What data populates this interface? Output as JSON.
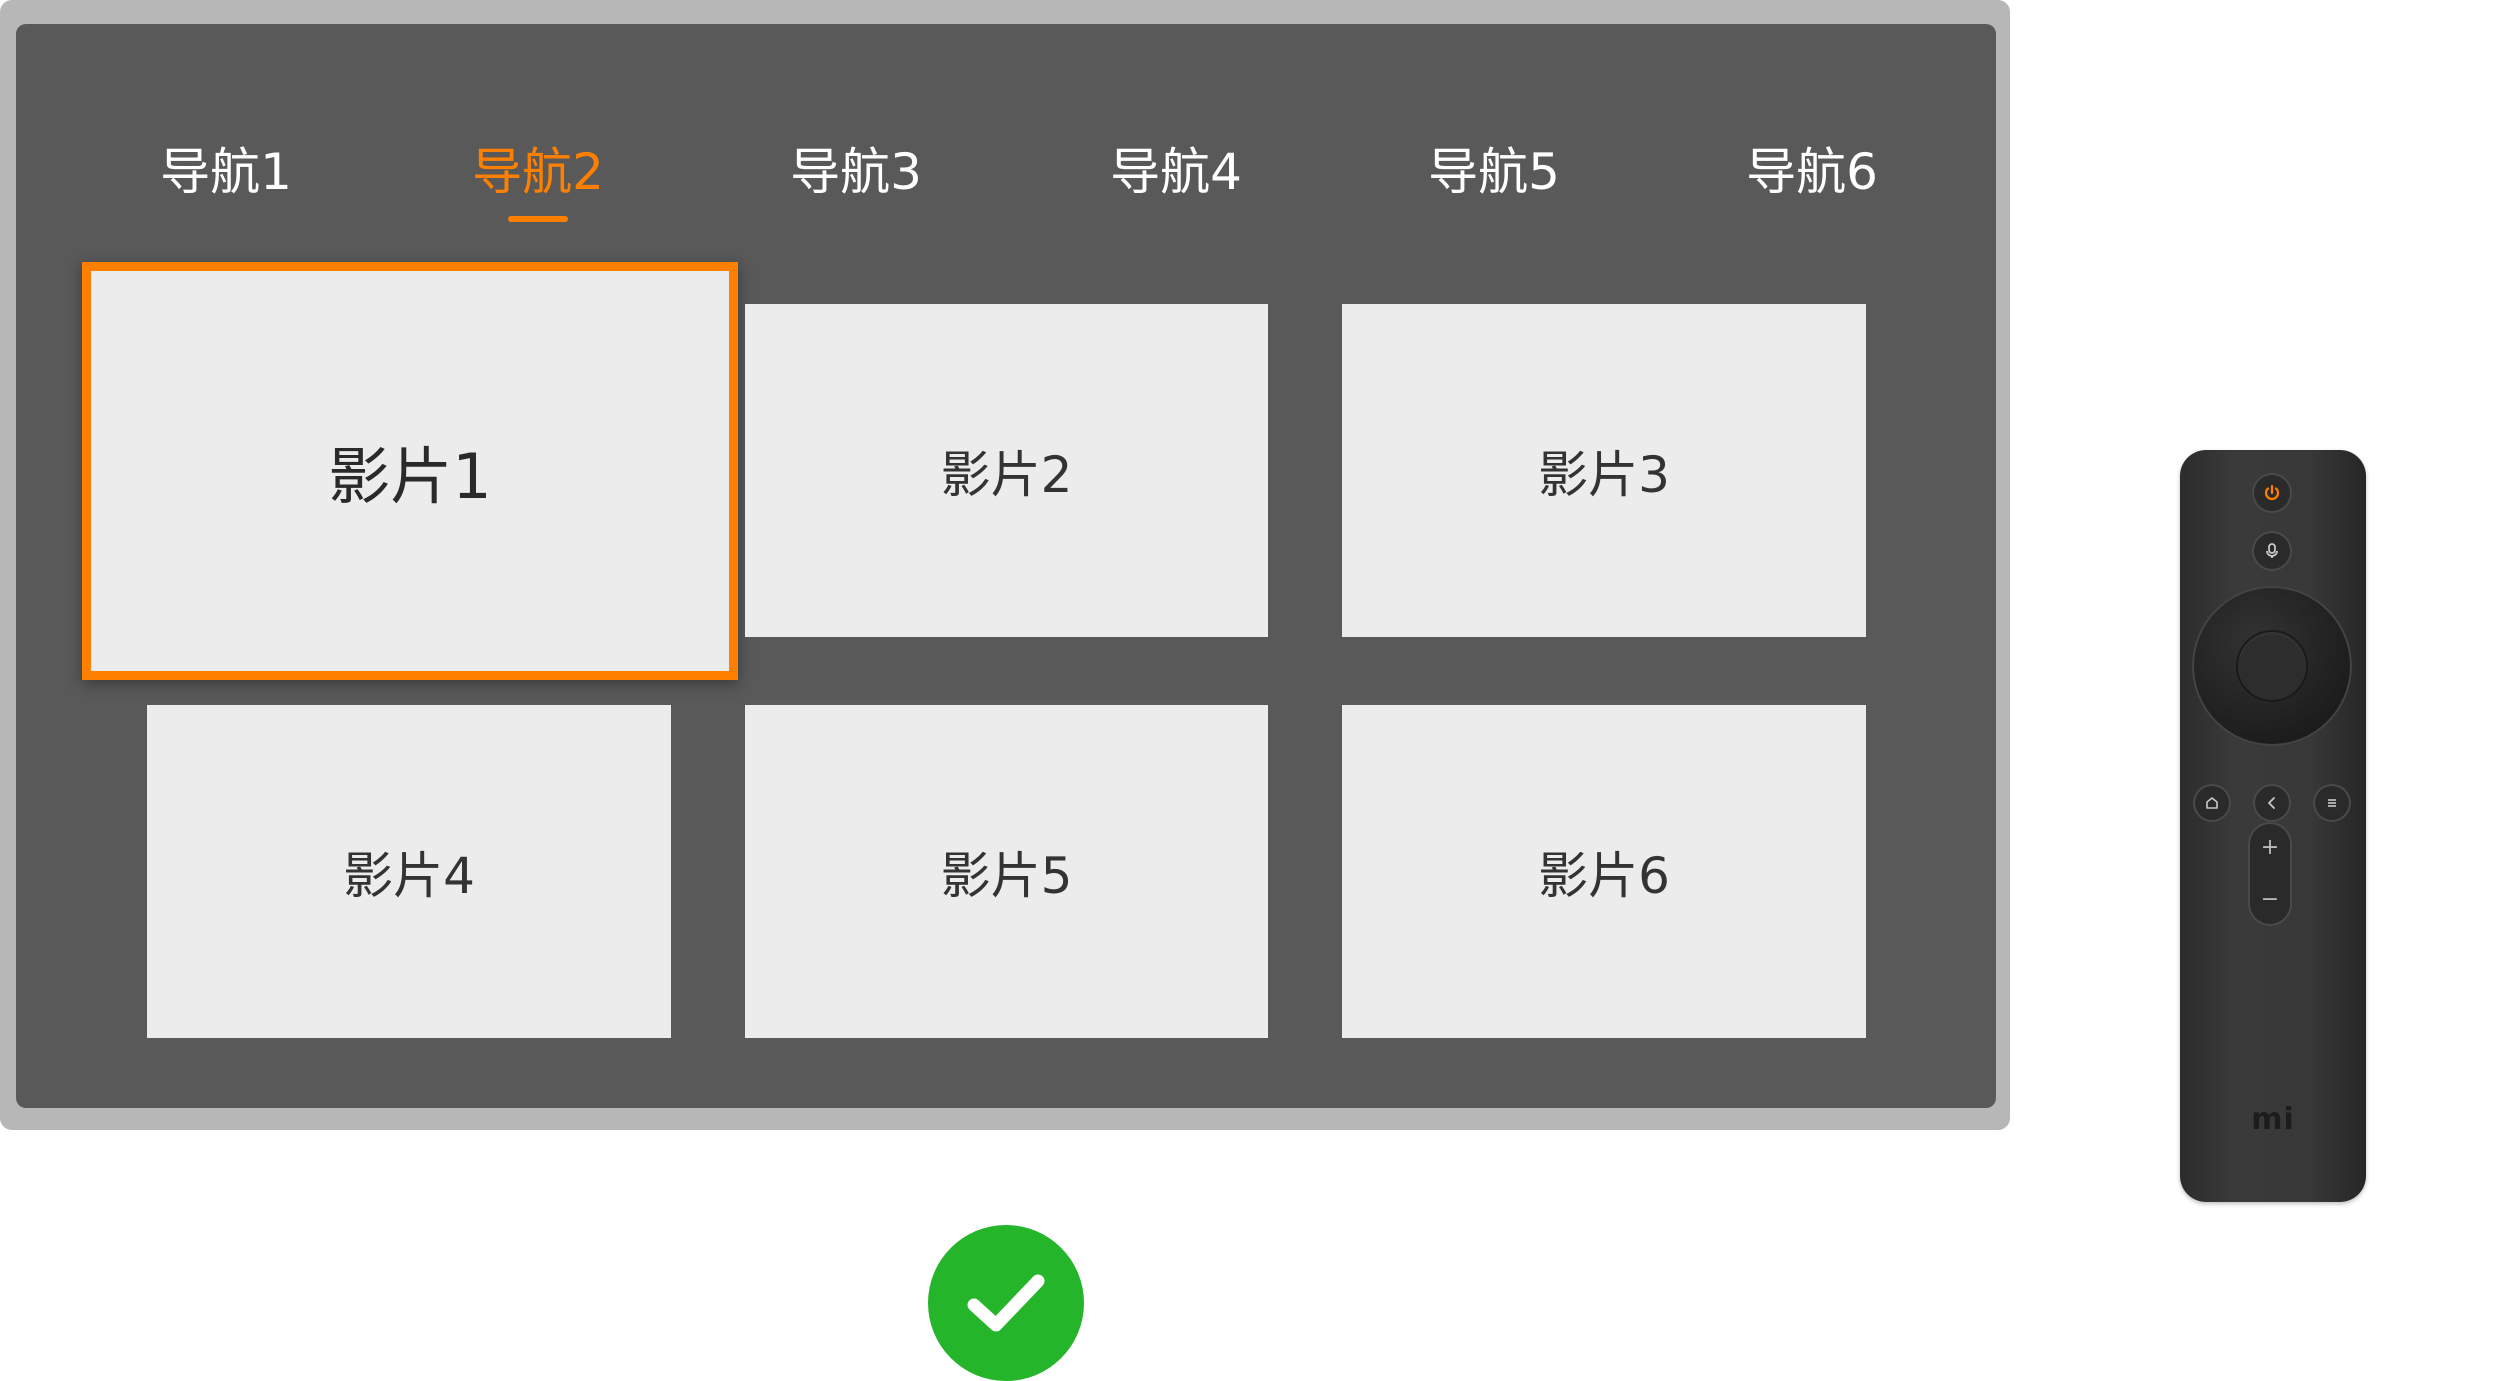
{
  "nav": {
    "tabs": [
      {
        "label": "导航1"
      },
      {
        "label": "导航2"
      },
      {
        "label": "导航3"
      },
      {
        "label": "导航4"
      },
      {
        "label": "导航5"
      },
      {
        "label": "导航6"
      }
    ],
    "active_index": 1
  },
  "movies": {
    "items": [
      {
        "label": "影片1"
      },
      {
        "label": "影片2"
      },
      {
        "label": "影片3"
      },
      {
        "label": "影片4"
      },
      {
        "label": "影片5"
      },
      {
        "label": "影片6"
      }
    ],
    "focused_index": 0
  },
  "remote": {
    "logo": "mi",
    "icons": [
      "power-icon",
      "microphone-icon",
      "home-icon",
      "back-icon",
      "menu-icon"
    ],
    "volume_up": "+",
    "volume_down": "−"
  },
  "status": {
    "icon": "check-icon"
  },
  "colors": {
    "accent": "#ff8000",
    "screen_bg": "#595959",
    "frame": "#b7b7b7",
    "card_bg": "#ececec",
    "success": "#25b52a"
  }
}
